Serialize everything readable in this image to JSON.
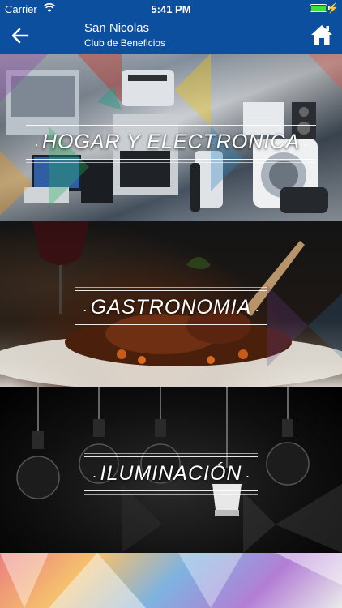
{
  "status_bar": {
    "carrier": "Carrier",
    "time": "5:41 PM",
    "battery_level": 1.0,
    "charging": true
  },
  "nav": {
    "title": "San Nicolas",
    "subtitle": "Club de Beneficios",
    "back_icon": "arrow-left-icon",
    "home_icon": "home-icon"
  },
  "categories": [
    {
      "label": "HOGAR Y ELECTRONICA"
    },
    {
      "label": "GASTRONOMIA"
    },
    {
      "label": "ILUMINACIÓN"
    }
  ],
  "colors": {
    "header": "#0d4f9f",
    "label_text": "#ffffff"
  }
}
